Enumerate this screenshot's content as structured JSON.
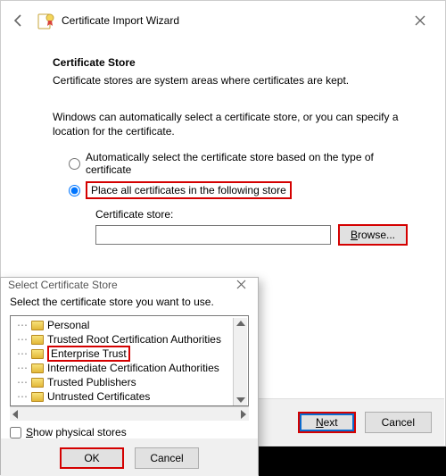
{
  "wizard": {
    "title": "Certificate Import Wizard",
    "section_title": "Certificate Store",
    "section_desc": "Certificate stores are system areas where certificates are kept.",
    "lead": "Windows can automatically select a certificate store, or you can specify a location for the certificate.",
    "opt_auto": "Automatically select the certificate store based on the type of certificate",
    "opt_place": "Place all certificates in the following store",
    "store_label": "Certificate store:",
    "store_value": "",
    "browse_label_pre": "B",
    "browse_label_post": "rowse...",
    "next_pre": "N",
    "next_post": "ext",
    "cancel": "Cancel"
  },
  "dlg": {
    "title": "Select Certificate Store",
    "msg": "Select the certificate store you want to use.",
    "items": [
      "Personal",
      "Trusted Root Certification Authorities",
      "Enterprise Trust",
      "Intermediate Certification Authorities",
      "Trusted Publishers",
      "Untrusted Certificates"
    ],
    "show_physical_pre": "S",
    "show_physical_post": "how physical stores",
    "ok": "OK",
    "cancel": "Cancel"
  }
}
